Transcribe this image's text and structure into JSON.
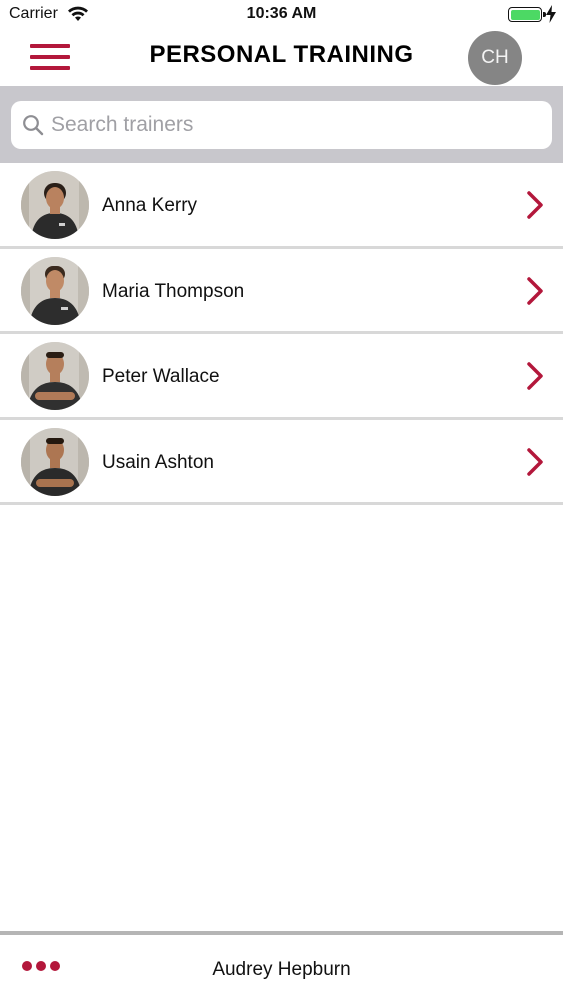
{
  "status_bar": {
    "carrier": "Carrier",
    "time": "10:36 AM",
    "battery_level": 1.0,
    "icons": [
      "wifi-icon",
      "battery-icon",
      "charging-bolt-icon"
    ]
  },
  "nav": {
    "menu_icon": "hamburger-menu-icon",
    "title": "PERSONAL TRAINING",
    "user_initials": "CH"
  },
  "search": {
    "placeholder": "Search trainers",
    "value": "",
    "icon": "search-icon"
  },
  "trainers": [
    {
      "name": "Anna Kerry"
    },
    {
      "name": "Maria Thompson"
    },
    {
      "name": "Peter Wallace"
    },
    {
      "name": "Usain Ashton"
    }
  ],
  "bottom_bar": {
    "more_icon": "more-dots-icon",
    "user_name": "Audrey Hepburn"
  },
  "colors": {
    "accent": "#b3173b",
    "search_background": "#c8c7cc",
    "avatar_background": "#858585",
    "battery_green": "#4cd964",
    "divider": "#d8d8d8"
  }
}
